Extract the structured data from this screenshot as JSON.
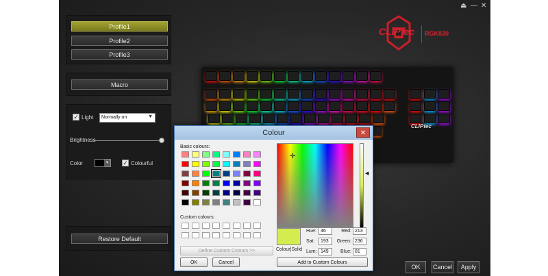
{
  "window": {
    "eject": "⏏",
    "minimize": "—",
    "close": "✕"
  },
  "brand": {
    "logo": "CLIPtec",
    "model": "RGK830"
  },
  "profiles": [
    "Profile1",
    "Profile2",
    "Profile3"
  ],
  "macro_label": "Macro",
  "light": {
    "label": "Light",
    "checked": true,
    "mode": "Normally on"
  },
  "brightness_label": "Brightness",
  "color_label": "Color",
  "colourful_label": "Colourful",
  "restore_label": "Restore Default",
  "footer": {
    "ok": "OK",
    "cancel": "Cancel",
    "apply": "Apply"
  },
  "keyboard_logo": "CLIPtec",
  "dialog": {
    "title": "Colour",
    "close": "✕",
    "basic_label": "Basic colours:",
    "custom_label": "Custom colours:",
    "define_label": "Define Custom Colours >>",
    "ok": "OK",
    "cancel": "Cancel",
    "colour_solid": "Colour|Solid",
    "hue_label": "Hue:",
    "hue": "46",
    "sat_label": "Sat:",
    "sat": "193",
    "lum_label": "Lum:",
    "lum": "149",
    "red_label": "Red:",
    "red": "213",
    "green_label": "Green:",
    "green": "236",
    "blue_label": "Blue:",
    "blue": "81",
    "add_label": "Add to Custom Colours",
    "selected_colour": "#d5ec51",
    "basic_colours": [
      "#ff8080",
      "#ffff80",
      "#80ff80",
      "#00ff80",
      "#80ffff",
      "#0080ff",
      "#ff80c0",
      "#ff80ff",
      "#ff0000",
      "#ffff00",
      "#80ff00",
      "#00ff40",
      "#00ffff",
      "#0080c0",
      "#8080c0",
      "#ff00ff",
      "#804040",
      "#ff8040",
      "#00ff00",
      "#008080",
      "#004080",
      "#8080ff",
      "#800040",
      "#ff0080",
      "#800000",
      "#ff8000",
      "#008000",
      "#008040",
      "#0000ff",
      "#0000a0",
      "#800080",
      "#8000ff",
      "#400000",
      "#804000",
      "#004000",
      "#004040",
      "#000080",
      "#000040",
      "#400040",
      "#400080",
      "#000000",
      "#808000",
      "#808040",
      "#808080",
      "#408080",
      "#c0c0c0",
      "#400040",
      "#ffffff"
    ],
    "selected_basic_index": 19
  }
}
